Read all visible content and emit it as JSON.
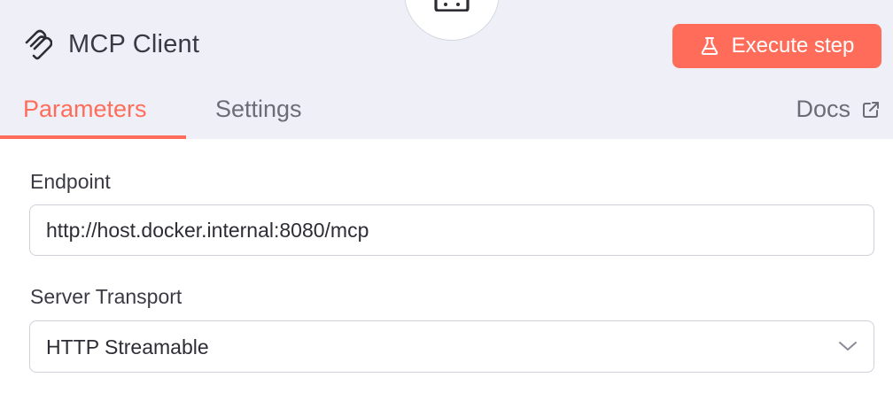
{
  "node": {
    "title": "MCP Client",
    "icon": "mcp-icon",
    "badge_icon": "node-badge-icon"
  },
  "header": {
    "execute_label": "Execute step",
    "execute_icon": "flask-icon",
    "docs_label": "Docs",
    "docs_icon": "external-link-icon"
  },
  "tabs": [
    {
      "label": "Parameters",
      "active": true
    },
    {
      "label": "Settings",
      "active": false
    }
  ],
  "fields": {
    "endpoint": {
      "label": "Endpoint",
      "value": "http://host.docker.internal:8080/mcp"
    },
    "transport": {
      "label": "Server Transport",
      "value": "HTTP Streamable",
      "icon": "chevron-down-icon"
    }
  },
  "colors": {
    "accent": "#ff6d5a",
    "header_bg": "#eff0f7",
    "muted_text": "#6b6c77",
    "border": "#cfd1da"
  }
}
